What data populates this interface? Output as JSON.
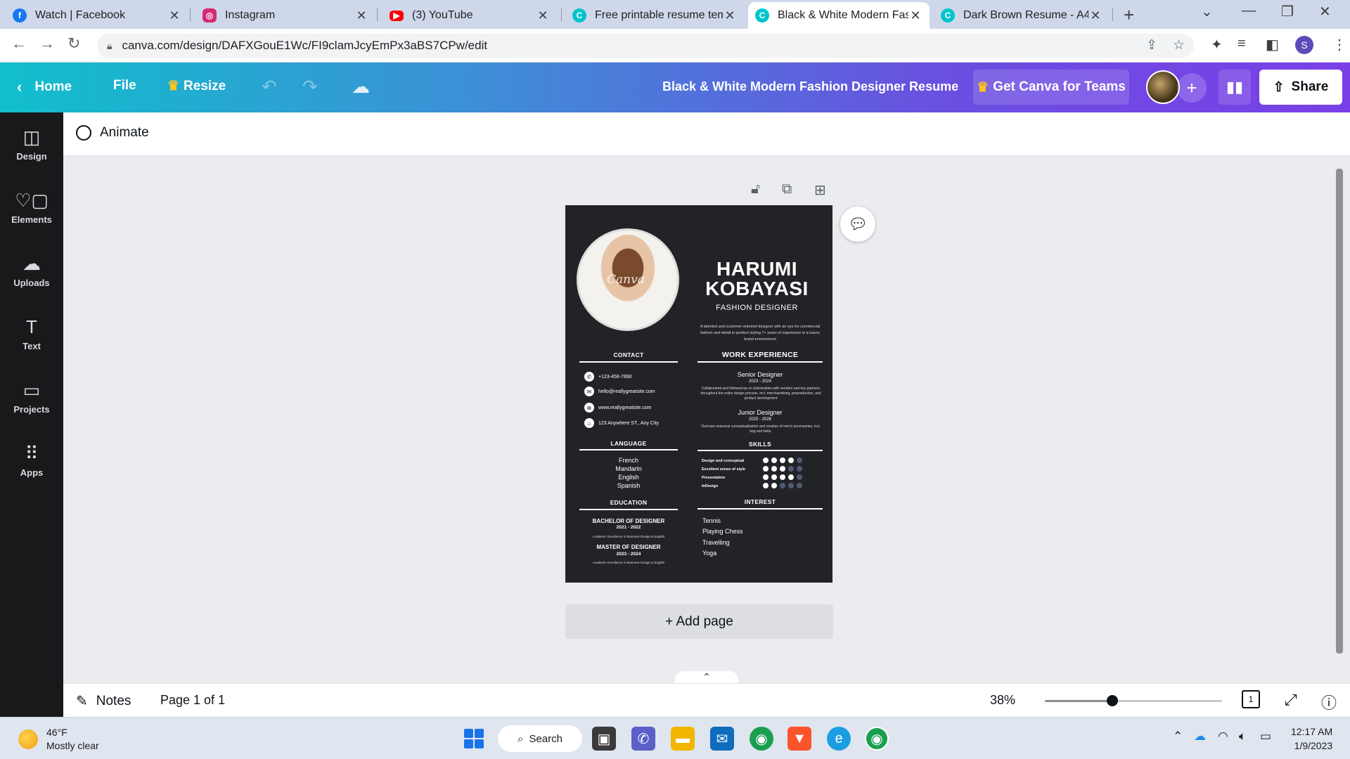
{
  "browser": {
    "tabs": [
      {
        "title": "Watch | Facebook",
        "icon": "facebook-icon",
        "color": "#1877f2"
      },
      {
        "title": "Instagram",
        "icon": "instagram-icon",
        "color": "#d62976"
      },
      {
        "title": "(3) YouTube",
        "icon": "youtube-icon",
        "color": "#ff0000"
      },
      {
        "title": "Free printable resume temp",
        "icon": "canva-icon",
        "color": "#00c4cc"
      },
      {
        "title": "Black & White Modern Fas",
        "icon": "canva-icon",
        "color": "#00c4cc",
        "active": true
      },
      {
        "title": "Dark Brown Resume - A4",
        "icon": "canva-icon",
        "color": "#00c4cc"
      }
    ],
    "url": "canva.com/design/DAFXGouE1Wc/FI9clamJcyEmPx3aBS7CPw/edit",
    "profile_initial": "S"
  },
  "canva": {
    "home_label": "Home",
    "file_label": "File",
    "resize_label": "Resize",
    "doc_title": "Black & White Modern Fashion Designer Resume",
    "teams_label": "Get Canva for Teams",
    "share_label": "Share",
    "brand_color": "#7d2ae8",
    "rail": [
      {
        "label": "Design",
        "icon": "design-icon"
      },
      {
        "label": "Elements",
        "icon": "elements-icon"
      },
      {
        "label": "Uploads",
        "icon": "uploads-icon"
      },
      {
        "label": "Text",
        "icon": "text-icon"
      },
      {
        "label": "Projects",
        "icon": "projects-icon"
      },
      {
        "label": "Apps",
        "icon": "apps-icon"
      }
    ],
    "animate_label": "Animate",
    "add_page_label": "+ Add page",
    "footer": {
      "notes_label": "Notes",
      "page_info": "Page 1 of 1",
      "zoom": "38%",
      "zoom_fraction": 0.38,
      "page_count": "1"
    }
  },
  "resume": {
    "watermark": "Canva",
    "name_line1": "HARUMI",
    "name_line2": "KOBAYASI",
    "role": "FASHION DESIGNER",
    "bio": "A talented and customer-oriented designer with an eye for commercial fashion and detail in product styling 7+ years of experience in a luxury brand environment",
    "contact_heading": "CONTACT",
    "contact": [
      {
        "text": "+123-456-7890",
        "icon": "phone-icon"
      },
      {
        "text": "hello@reallygreatsite.com",
        "icon": "mail-icon"
      },
      {
        "text": "www.reallygreatsite.com",
        "icon": "globe-icon"
      },
      {
        "text": "123 Anywhere ST., Any City",
        "icon": "home-icon"
      }
    ],
    "language_heading": "LANGUAGE",
    "languages": [
      "French",
      "Mandarin",
      "English",
      "Spanish"
    ],
    "education_heading": "EDUCATION",
    "education": [
      {
        "degree": "BACHELOR OF DESIGNER",
        "years": "2021 - 2022",
        "detail": "Academic Excellence in Business Design & English"
      },
      {
        "degree": "MASTER OF DESIGNER",
        "years": "2023 - 2024",
        "detail": "Academic Excellence in Business Design & English"
      }
    ],
    "work_heading": "WORK EXPERIENCE",
    "jobs": [
      {
        "title": "Senior Designer",
        "years": "2023 - 2024",
        "detail": "Collaborated and followed-up on deliverables with vendors and key partners throughout the entire design process, incl. merchandising, preproduction, and product development"
      },
      {
        "title": "Junior Designer",
        "years": "2025 - 2026",
        "detail": "Oversaw seasonal conceptualization and creation of men's accessories, incl. bag and belts."
      }
    ],
    "skills_heading": "SKILLS",
    "skills": [
      {
        "name": "Design and conceptual",
        "level": 4,
        "max": 5
      },
      {
        "name": "Excellent sense of style",
        "level": 3,
        "max": 5
      },
      {
        "name": "Presentation",
        "level": 4,
        "max": 5
      },
      {
        "name": "InDesign",
        "level": 2,
        "max": 5
      }
    ],
    "interest_heading": "INTEREST",
    "interests": [
      "Tennis",
      "Playing Chess",
      "Travelling",
      "Yoga"
    ]
  },
  "taskbar": {
    "temperature": "46°F",
    "weather": "Mostly clear",
    "search_label": "Search",
    "time": "12:17 AM",
    "date": "1/9/2023"
  }
}
